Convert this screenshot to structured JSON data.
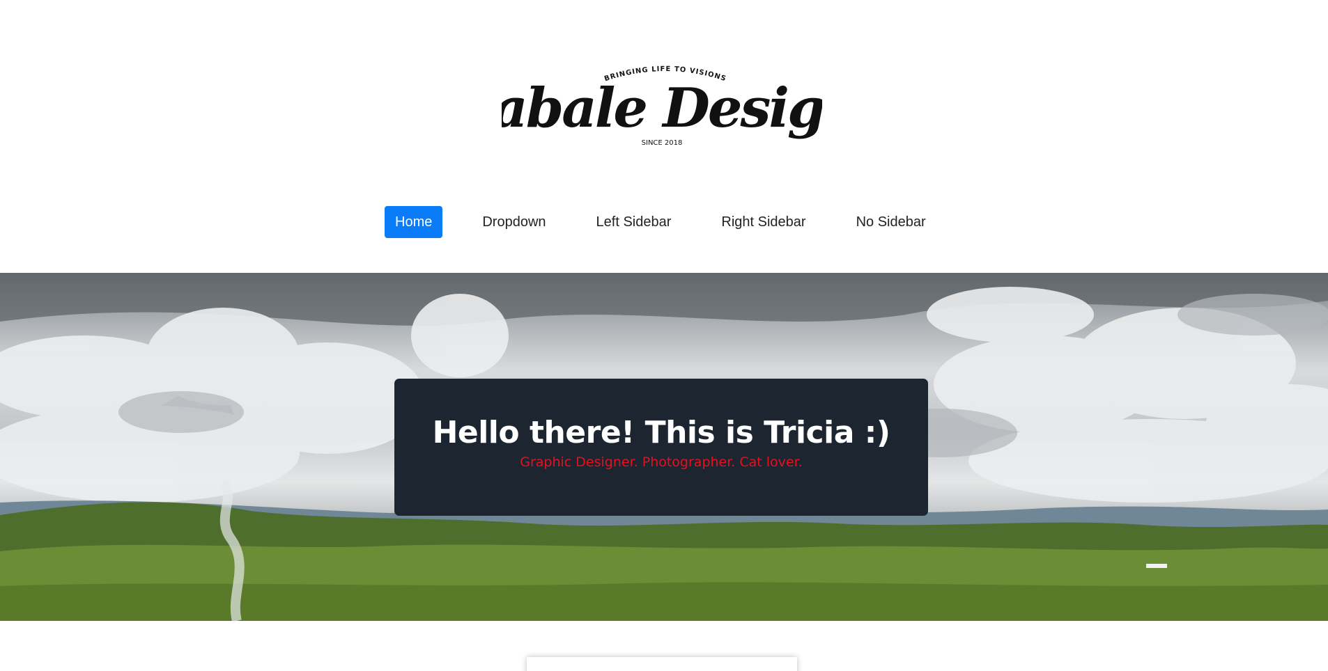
{
  "logo": {
    "tagline": "BRINGING LIFE TO VISIONS",
    "name": "Mabale Designs",
    "since": "SINCE 2018"
  },
  "nav": {
    "items": [
      {
        "label": "Home",
        "active": true
      },
      {
        "label": "Dropdown",
        "active": false
      },
      {
        "label": "Left Sidebar",
        "active": false
      },
      {
        "label": "Right Sidebar",
        "active": false
      },
      {
        "label": "No Sidebar",
        "active": false
      }
    ],
    "active_color": "#0a7cf7"
  },
  "hero": {
    "title": "Hello there! This is Tricia :)",
    "subtitle": "Graphic Designer. Photographer. Cat lover.",
    "card_color": "#1d2531",
    "subtitle_color": "#e8101d"
  }
}
